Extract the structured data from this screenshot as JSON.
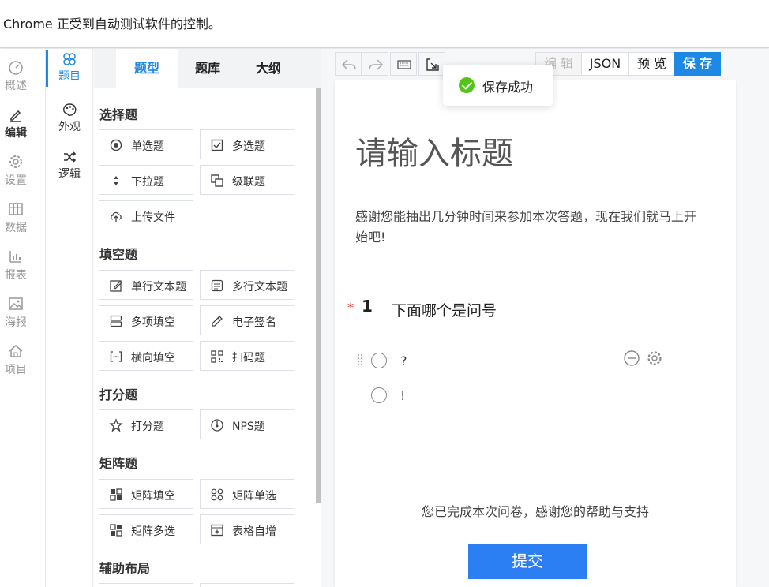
{
  "infobar": {
    "text": "Chrome 正受到自动测试软件的控制。"
  },
  "nav": [
    {
      "label": "概述",
      "icon": "dashboard-icon"
    },
    {
      "label": "编辑",
      "icon": "edit-icon"
    },
    {
      "label": "设置",
      "icon": "gear-icon"
    },
    {
      "label": "数据",
      "icon": "table-icon"
    },
    {
      "label": "报表",
      "icon": "chart-icon"
    },
    {
      "label": "海报",
      "icon": "image-icon"
    },
    {
      "label": "项目",
      "icon": "home-icon"
    }
  ],
  "nav2": [
    {
      "label": "题目",
      "icon": "clover-icon"
    },
    {
      "label": "外观",
      "icon": "palette-icon"
    },
    {
      "label": "逻辑",
      "icon": "shuffle-icon"
    }
  ],
  "tabs": [
    "题型",
    "题库",
    "大纲"
  ],
  "sections": [
    {
      "title": "选择题",
      "items": [
        "单选题",
        "多选题",
        "下拉题",
        "级联题",
        "上传文件"
      ]
    },
    {
      "title": "填空题",
      "items": [
        "单行文本题",
        "多行文本题",
        "多项填空",
        "电子签名",
        "横向填空",
        "扫码题"
      ]
    },
    {
      "title": "打分题",
      "items": [
        "打分题",
        "NPS题"
      ]
    },
    {
      "title": "矩阵题",
      "items": [
        "矩阵填空",
        "矩阵单选",
        "矩阵多选",
        "表格自增"
      ]
    },
    {
      "title": "辅助布局",
      "items": []
    }
  ],
  "toolbar": {
    "edit": "编 辑",
    "json": "JSON",
    "preview": "预 览",
    "save": "保 存"
  },
  "toast": {
    "message": "保存成功"
  },
  "form": {
    "title": "请输入标题",
    "description": "感谢您能抽出几分钟时间来参加本次答题，现在我们就马上开始吧!",
    "question": {
      "required_mark": "*",
      "number": "1",
      "title": "下面哪个是问号",
      "options": [
        "?",
        "!"
      ]
    },
    "footer": "您已完成本次问卷，感谢您的帮助与支持",
    "submit": "提交"
  },
  "colors": {
    "primary": "#1e88e5",
    "submit": "#2b7ff2",
    "success": "#52c41a",
    "required": "#e53935"
  }
}
